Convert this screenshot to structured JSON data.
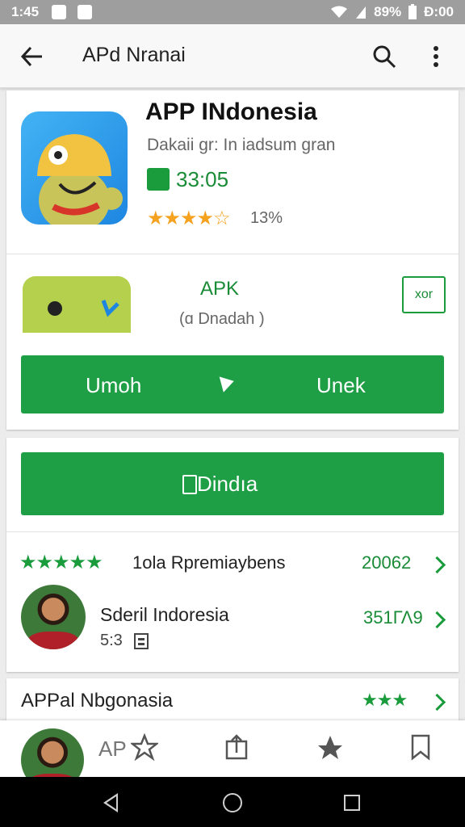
{
  "status_bar": {
    "time": "1:45",
    "battery": "89%",
    "clock_right": "Ð:00"
  },
  "app_bar": {
    "title": "APd Nranai"
  },
  "app_header": {
    "name": "APP INdonesia",
    "developer": "Dakaii gr: In iadsum gran",
    "size": "33:05",
    "stars": "★★★★☆",
    "rating_text": "13%"
  },
  "apk_section": {
    "title": "APK",
    "subtitle": "(ɑ Dnadah )",
    "small_button": "xor",
    "left_action": "Umoh",
    "right_action": "Unek"
  },
  "download_button": {
    "label": "Dindıa"
  },
  "rows": [
    {
      "stars": "★★★★★",
      "label": "1ola Rpremiaybens",
      "value": "20062"
    },
    {
      "name": "Sderil Indoresia",
      "sub": "5:3",
      "value": "351ΓΛ9"
    }
  ],
  "section3": {
    "title": "APPal Nbgonasia",
    "stars": "★★★"
  },
  "bottom_nav": {
    "text": "AP"
  },
  "colors": {
    "green": "#1e9e45",
    "star_orange": "#f4a21f",
    "app_bar": "#f8f8f8"
  }
}
